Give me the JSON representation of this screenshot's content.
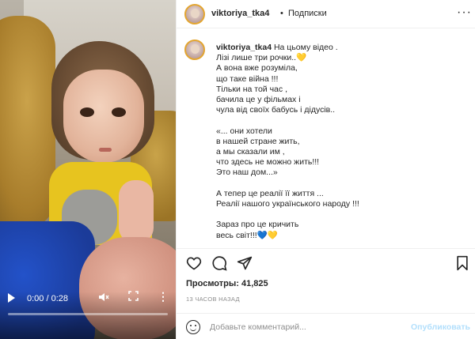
{
  "video": {
    "time_display": "0:00 / 0:28",
    "progress": 0,
    "icons": [
      "play-icon",
      "mute-icon",
      "fullscreen-icon",
      "more-options-icon"
    ]
  },
  "header": {
    "username": "viktoriya_tka4",
    "separator": "•",
    "follow_label": "Подписки",
    "menu_label": "···"
  },
  "caption": {
    "username": "viktoriya_tka4",
    "text": "На цьому відео .\nЛізі лише три рочки..💛\nА вона вже розуміла,\nщо таке війна !!!\nТільки на той час ,\nбачила це у фільмах і\nчула від своїх бабусь і дідусів..\n\n«... они хотели\nв нашей стране жить,\nа мы сказали им ,\nчто здесь не можно жить!!!\nЭто наш дом...»\n\nА тепер це реалії її життя ...\nРеалії нашого українського народу !!!\n\nЗараз про це кричить\nвесь світ!!!💙💛"
  },
  "stats": {
    "views_label": "Просмотры:",
    "views_value": "41,825",
    "time_ago": "13 ЧАСОВ НАЗАД"
  },
  "comment": {
    "placeholder": "Добавьте комментарий...",
    "publish_label": "Опубликовать"
  },
  "colors": {
    "publish": "#b2dffc",
    "story_ring": "#e3a530",
    "text": "#262626",
    "muted": "#8e8e8e"
  }
}
